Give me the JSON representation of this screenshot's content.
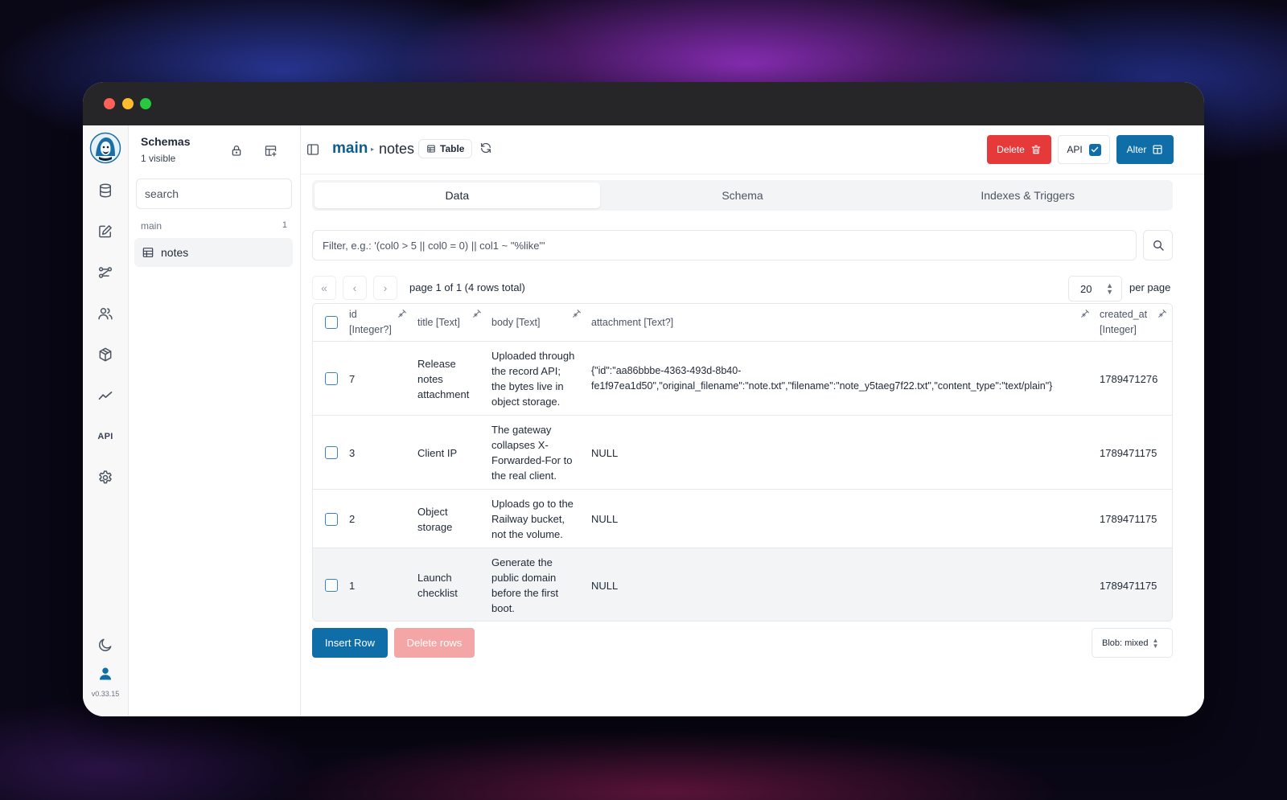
{
  "sidebar": {
    "title": "Schemas",
    "subtitle": "1 visible",
    "search_placeholder": "search",
    "group": {
      "name": "main",
      "count": "1"
    },
    "items": [
      {
        "label": "notes"
      }
    ]
  },
  "rail": {
    "api_label": "API",
    "version": "v0.33.15"
  },
  "header": {
    "breadcrumb_schema": "main",
    "breadcrumb_table": "notes",
    "table_badge": "Table",
    "delete_label": "Delete",
    "api_label": "API",
    "alter_label": "Alter"
  },
  "tabs": [
    {
      "label": "Data"
    },
    {
      "label": "Schema"
    },
    {
      "label": "Indexes & Triggers"
    }
  ],
  "filter": {
    "placeholder": "Filter, e.g.: '(col0 > 5 || col0 = 0) || col1 ~ \"%like\"'"
  },
  "pagination": {
    "info": "page 1 of 1 (4 rows total)",
    "per_page_value": "20",
    "per_page_label": "per page"
  },
  "table": {
    "columns": [
      {
        "name": "id",
        "type": "[Integer?]"
      },
      {
        "label": "title [Text]"
      },
      {
        "label": "body [Text]"
      },
      {
        "label": "attachment [Text?]"
      },
      {
        "name": "created_at",
        "type": "[Integer]"
      }
    ],
    "rows": [
      {
        "id": "7",
        "title": [
          "Release",
          "notes",
          "attachment"
        ],
        "body": [
          "Uploaded through",
          "the record API;",
          "the bytes live in",
          "object storage."
        ],
        "attachment": [
          "{\"id\":\"aa86bbbe-4363-493d-8b40-",
          "fe1f97ea1d50\",\"original_filename\":\"note.txt\",\"filename\":\"note_y5taeg7f22.txt\",\"content_type\":\"text/plain\"}"
        ],
        "created_at": "1789471276"
      },
      {
        "id": "3",
        "title": [
          "Client IP"
        ],
        "body": [
          "The gateway",
          "collapses X-",
          "Forwarded-For to",
          "the real client."
        ],
        "attachment": [
          "NULL"
        ],
        "created_at": "1789471175"
      },
      {
        "id": "2",
        "title": [
          "Object",
          "storage"
        ],
        "body": [
          "Uploads go to the",
          "Railway bucket,",
          "not the volume."
        ],
        "attachment": [
          "NULL"
        ],
        "created_at": "1789471175"
      },
      {
        "id": "1",
        "title": [
          "Launch",
          "checklist"
        ],
        "body": [
          "Generate the",
          "public domain",
          "before the first",
          "boot."
        ],
        "attachment": [
          "NULL"
        ],
        "created_at": "1789471175"
      }
    ]
  },
  "footer": {
    "insert_label": "Insert Row",
    "delete_rows_label": "Delete rows",
    "blob_mode": "Blob: mixed"
  },
  "colors": {
    "brand": "#0f6ea8",
    "link": "#0f5d8e",
    "danger": "#e63a3a",
    "danger_disabled": "#f4a6a6"
  }
}
